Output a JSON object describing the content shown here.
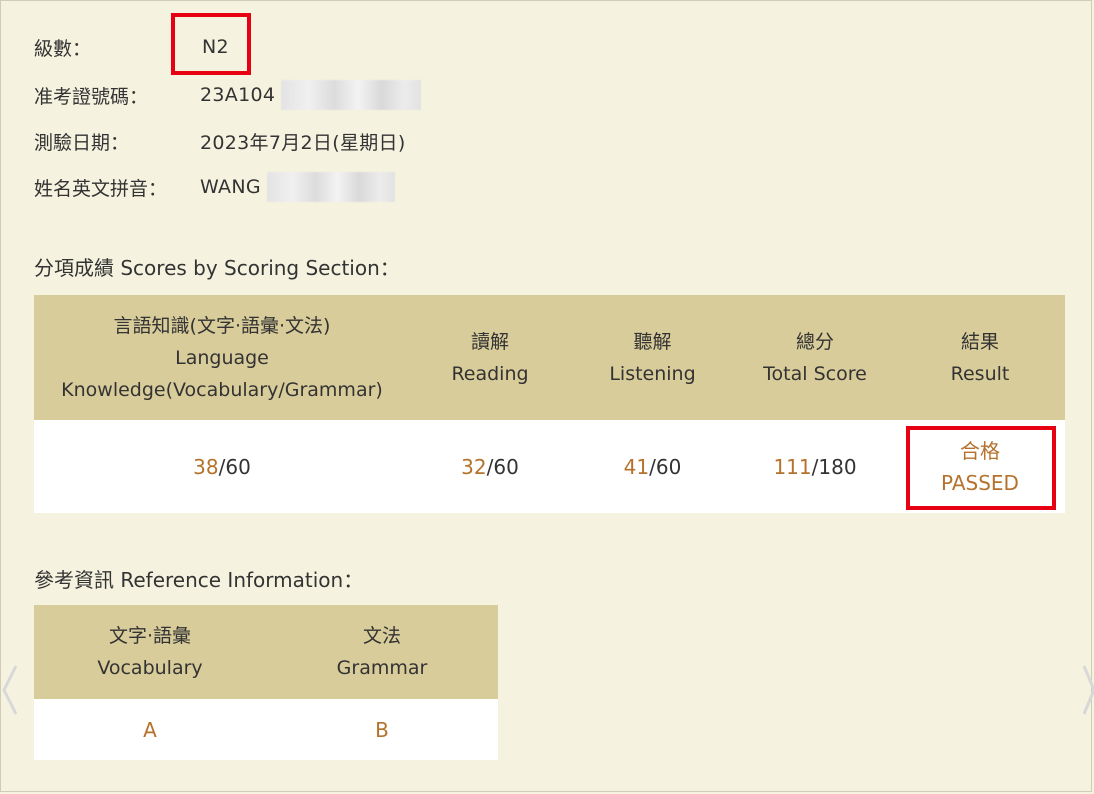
{
  "info": {
    "level_label": "級數：",
    "level_value": "N2",
    "exam_no_label": "准考證號碼：",
    "exam_no_value": "23A104",
    "date_label": "測驗日期：",
    "date_value": "2023年7月2日(星期日)",
    "name_label": "姓名英文拼音：",
    "name_value": "WANG"
  },
  "scores_section": {
    "title": "分項成績 Scores by Scoring Section：",
    "headers": [
      {
        "zh": "言語知識(文字·語彙·文法)",
        "en1": "Language",
        "en2": "Knowledge(Vocabulary/Grammar)"
      },
      {
        "zh": "讀解",
        "en1": "Reading",
        "en2": ""
      },
      {
        "zh": "聽解",
        "en1": "Listening",
        "en2": ""
      },
      {
        "zh": "總分",
        "en1": "Total Score",
        "en2": ""
      },
      {
        "zh": "結果",
        "en1": "Result",
        "en2": ""
      }
    ],
    "values": [
      {
        "score": "38",
        "max": "/60"
      },
      {
        "score": "32",
        "max": "/60"
      },
      {
        "score": "41",
        "max": "/60"
      },
      {
        "score": "111",
        "max": "/180"
      }
    ],
    "result_zh": "合格",
    "result_en": "PASSED"
  },
  "reference_section": {
    "title": "參考資訊 Reference Information：",
    "headers": [
      {
        "zh": "文字·語彙",
        "en": "Vocabulary"
      },
      {
        "zh": "文法",
        "en": "Grammar"
      }
    ],
    "values": [
      "A",
      "B"
    ]
  },
  "colors": {
    "background": "#f5f3df",
    "header": "#d9cc9b",
    "score_accent": "#b5722c",
    "highlight_box": "#e60012"
  }
}
